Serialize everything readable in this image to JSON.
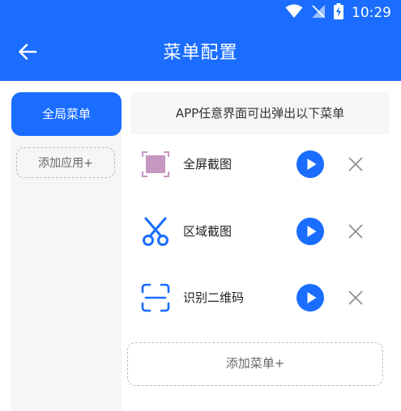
{
  "status_bar": {
    "time": "10:29",
    "icons": [
      "wifi-icon",
      "no-signal-icon",
      "battery-charging-icon"
    ]
  },
  "toolbar": {
    "title": "菜单配置",
    "back_icon": "arrow-left-icon"
  },
  "sidebar": {
    "active_tab": "全局菜单",
    "add_app_label": "添加应用+"
  },
  "main": {
    "description": "APP任意界面可出弹出以下菜单",
    "items": [
      {
        "label": "全屏截图",
        "icon": "fullscreen-screenshot-icon"
      },
      {
        "label": "区域截图",
        "icon": "scissors-icon"
      },
      {
        "label": "识别二维码",
        "icon": "scan-qr-icon"
      }
    ],
    "add_menu_label": "添加菜单+"
  },
  "colors": {
    "accent": "#1a6dff",
    "panel_bg": "#f6f6f6",
    "fullscreen_icon": "#c597c1"
  }
}
